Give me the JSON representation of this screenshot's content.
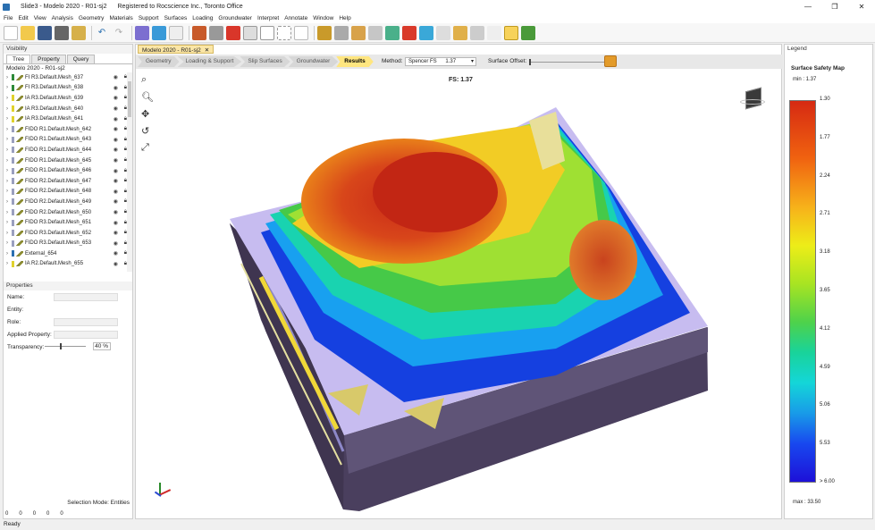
{
  "window": {
    "title": "Slide3 - Modelo 2020 - R01-sj2",
    "registered": "Registered to Rocscience Inc., Toronto Office"
  },
  "menu": [
    "File",
    "Edit",
    "View",
    "Analysis",
    "Geometry",
    "Materials",
    "Support",
    "Surfaces",
    "Loading",
    "Groundwater",
    "Interpret",
    "Annotate",
    "Window",
    "Help"
  ],
  "left_panel": {
    "title": "Visibility",
    "tabs": [
      "Tree",
      "Property",
      "Query"
    ],
    "project": "Modelo 2020 - R01-sj2",
    "items": [
      {
        "label": "FI R3.Default.Mesh_637",
        "color": "#2d8a3a"
      },
      {
        "label": "FI R3.Default.Mesh_638",
        "color": "#2d8a3a"
      },
      {
        "label": "IA R3.Default.Mesh_639",
        "color": "#e0d22c"
      },
      {
        "label": "IA R3.Default.Mesh_640",
        "color": "#e0d22c"
      },
      {
        "label": "IA R3.Default.Mesh_641",
        "color": "#e0d22c"
      },
      {
        "label": "FIDO R1.Default.Mesh_642",
        "color": "#9a9fbf"
      },
      {
        "label": "FIDO R1.Default.Mesh_643",
        "color": "#9a9fbf"
      },
      {
        "label": "FIDO R1.Default.Mesh_644",
        "color": "#9a9fbf"
      },
      {
        "label": "FIDO R1.Default.Mesh_645",
        "color": "#9a9fbf"
      },
      {
        "label": "FIDO R1.Default.Mesh_646",
        "color": "#9a9fbf"
      },
      {
        "label": "FIDO R2.Default.Mesh_647",
        "color": "#9a9fbf"
      },
      {
        "label": "FIDO R2.Default.Mesh_648",
        "color": "#9a9fbf"
      },
      {
        "label": "FIDO R2.Default.Mesh_649",
        "color": "#9a9fbf"
      },
      {
        "label": "FIDO R2.Default.Mesh_650",
        "color": "#9a9fbf"
      },
      {
        "label": "FIDO R3.Default.Mesh_651",
        "color": "#9a9fbf"
      },
      {
        "label": "FIDO R3.Default.Mesh_652",
        "color": "#9a9fbf"
      },
      {
        "label": "FIDO R3.Default.Mesh_653",
        "color": "#9a9fbf"
      },
      {
        "label": "External_654",
        "color": "#2a6fb0"
      },
      {
        "label": "IA R2.Default.Mesh_655",
        "color": "#e0d22c"
      }
    ]
  },
  "properties": {
    "title": "Properties",
    "name_label": "Name:",
    "entity_label": "Entity:",
    "role_label": "Role:",
    "applied_label": "Applied Property:",
    "transparency_label": "Transparency:",
    "transparency_value": "40 %",
    "selection_mode": "Selection Mode: Entities",
    "status_counts": [
      "0",
      "0",
      "0",
      "0",
      "0"
    ]
  },
  "document": {
    "tab": "Modelo 2020 - R01-sj2",
    "workflow": [
      "Geometry",
      "Loading & Support",
      "Slip Surfaces",
      "Groundwater",
      "Results"
    ],
    "active_step": "Results",
    "method_label": "Method:",
    "method_value": "Spencer FS",
    "method_fs": "1.37",
    "offset_label": "Surface Offset:",
    "fs_label": "FS: 1.37"
  },
  "legend": {
    "title": "Legend",
    "map_title": "Surface Safety Map",
    "min": "min : 1.37",
    "max": "max : 33.50",
    "ticks": [
      "1.30",
      "1.77",
      "2.24",
      "2.71",
      "3.18",
      "3.65",
      "4.12",
      "4.59",
      "5.06",
      "5.53",
      "> 6.00"
    ]
  },
  "status": "Ready"
}
